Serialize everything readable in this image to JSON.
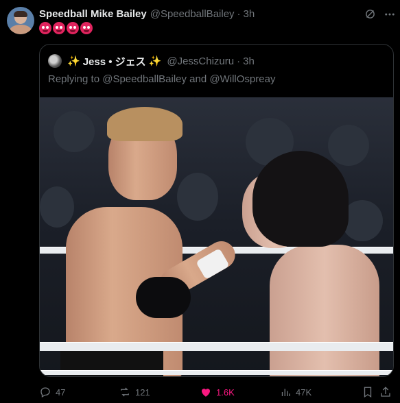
{
  "author": {
    "name": "Speedball Mike Bailey",
    "handle": "@SpeedballBailey",
    "separator": "·",
    "time": "3h",
    "emoji_count": 4,
    "emoji_name": "angry-face-with-symbols"
  },
  "quoted": {
    "name_prefix": "✨",
    "name": "Jess • ジェス",
    "name_suffix": "✨",
    "handle": "@JessChizuru",
    "separator": "·",
    "time": "3h",
    "replying_to": "Replying to @SpeedballBailey and @WillOspreay",
    "image_description_icon": "photo"
  },
  "actions": {
    "replies": "47",
    "reposts": "121",
    "likes": "1.6K",
    "views": "47K"
  },
  "colors": {
    "background": "#000000",
    "text": "#e7e9ea",
    "secondary": "#71767b",
    "border": "#2f3336",
    "like": "#f91880"
  },
  "icons": [
    "grok-icon",
    "more-icon",
    "reply-icon",
    "repost-icon",
    "like-icon",
    "views-icon",
    "bookmark-icon",
    "share-icon"
  ]
}
